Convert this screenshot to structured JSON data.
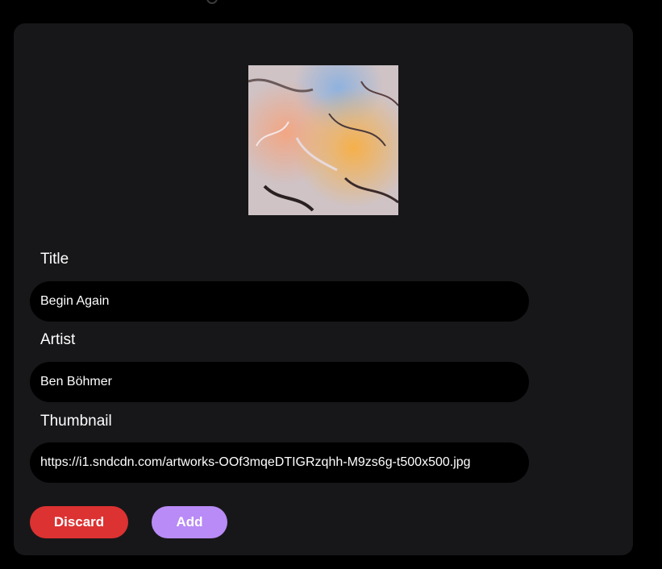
{
  "form": {
    "thumbnail_alt": "album-artwork",
    "title_label": "Title",
    "title_value": "Begin Again",
    "artist_label": "Artist",
    "artist_value": "Ben Böhmer",
    "thumbnail_label": "Thumbnail",
    "thumbnail_value": "https://i1.sndcdn.com/artworks-OOf3mqeDTIGRzqhh-M9zs6g-t500x500.jpg"
  },
  "buttons": {
    "discard_label": "Discard",
    "add_label": "Add"
  },
  "colors": {
    "page_bg": "#000000",
    "card_bg": "#171719",
    "input_bg": "#000000",
    "discard": "#dc3232",
    "add": "#b98bf6"
  }
}
